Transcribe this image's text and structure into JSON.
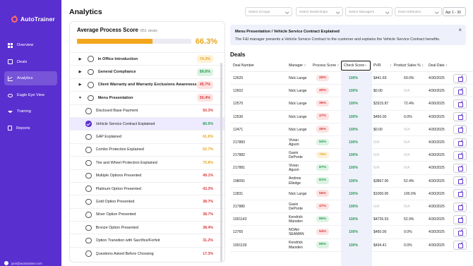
{
  "app": {
    "name": "AutoTrainer"
  },
  "sidebar": {
    "items": [
      {
        "label": "Overview",
        "icon": "grid-icon"
      },
      {
        "label": "Deals",
        "icon": "box-icon"
      },
      {
        "label": "Analytics",
        "icon": "chart-icon",
        "active": true
      },
      {
        "label": "Eagle Eye View",
        "icon": "eye-icon"
      },
      {
        "label": "Training",
        "icon": "graduation-cap-icon"
      },
      {
        "label": "Reports",
        "icon": "document-icon"
      }
    ],
    "user_email": "jack@autotrainer.com"
  },
  "header": {
    "title": "Analytics",
    "filters": [
      "Select Groups",
      "Select Dealerships",
      "Select Managers",
      "Deal Attribution"
    ],
    "date_range": "Apr 1 - 30"
  },
  "process_score": {
    "title": "Average Process Score",
    "deals_count": "851 deals",
    "overall": "66.3%",
    "progress_fraction": 0.663,
    "rows": [
      {
        "label": "In Office Introduction",
        "pct": "74.3%",
        "level": "top",
        "expand": "▶",
        "color": "#e7a61a",
        "bg": "#fff1d8"
      },
      {
        "label": "General Compliance",
        "pct": "89.6%",
        "level": "top",
        "expand": "▶",
        "color": "#2a9b53",
        "bg": "#dcf3e3"
      },
      {
        "label": "Client Warranty and Warranty Exclusions Awareness",
        "pct": "45.7%",
        "level": "top",
        "expand": "▶",
        "color": "#d83a3a",
        "bg": "#fde2e2"
      },
      {
        "label": "Menu Presentation",
        "pct": "50.4%",
        "level": "top",
        "expand": "▼",
        "color": "#d83a3a",
        "bg": "#fde2e2"
      },
      {
        "label": "Disclosed Base Payment",
        "pct": "50.3%",
        "level": "sub",
        "color": "#d83a3a"
      },
      {
        "label": "Vehicle Service Contract Explained",
        "pct": "80.5%",
        "level": "sub",
        "color": "#2a9b53",
        "selected": true
      },
      {
        "label": "GAP Explained",
        "pct": "61.6%",
        "level": "sub",
        "color": "#e7a61a"
      },
      {
        "label": "Combo Protection Explained",
        "pct": "62.7%",
        "level": "sub",
        "color": "#e7a61a"
      },
      {
        "label": "Tire and Wheel Protection Explained",
        "pct": "75.8%",
        "level": "sub",
        "color": "#e7a61a"
      },
      {
        "label": "Multiple Options Presented",
        "pct": "49.1%",
        "level": "sub",
        "color": "#d83a3a"
      },
      {
        "label": "Platinum Option Presented",
        "pct": "43.3%",
        "level": "sub",
        "color": "#d83a3a"
      },
      {
        "label": "Gold Option Presented",
        "pct": "38.7%",
        "level": "sub",
        "color": "#d83a3a"
      },
      {
        "label": "Silver Option Presented",
        "pct": "38.7%",
        "level": "sub",
        "color": "#d83a3a"
      },
      {
        "label": "Bronze Option Presented",
        "pct": "38.4%",
        "level": "sub",
        "color": "#d83a3a"
      },
      {
        "label": "Option Transition with Sacrifice/Forfeit",
        "pct": "31.2%",
        "level": "sub",
        "color": "#d83a3a"
      },
      {
        "label": "Questions Asked Before Choosing",
        "pct": "17.3%",
        "level": "sub",
        "color": "#d83a3a"
      }
    ]
  },
  "banner": {
    "title": "Menu Presentation / Vehicle Service Contract Explained",
    "text": "The F&I manager presents a Vehicle Service Contract to the customer and explains the Vehicle Service Contract benefits.",
    "close": "×"
  },
  "deals": {
    "title": "Deals",
    "columns": [
      "Deal Number",
      "Manager",
      "Process Score",
      "Check Score",
      "PVR",
      "Product Sales %",
      "Deal Date"
    ],
    "rows": [
      {
        "deal": "12625",
        "manager": "Nick Lange",
        "score": "45%",
        "check": "100%",
        "pvr": "$441.69",
        "sales": "69.0%",
        "date": "4/30/2025",
        "band": "red"
      },
      {
        "deal": "12602",
        "manager": "Nick Lange",
        "score": "40%",
        "check": "100%",
        "pvr": "$0.00",
        "sales": "N/A",
        "date": "4/30/2025",
        "band": "red"
      },
      {
        "deal": "12570",
        "manager": "Nick Lange",
        "score": "36%",
        "check": "100%",
        "pvr": "$3315.87",
        "sales": "72.4%",
        "date": "4/30/2025",
        "band": "red"
      },
      {
        "deal": "12536",
        "manager": "Nick Lange",
        "score": "47%",
        "check": "100%",
        "pvr": "$450.00",
        "sales": "0.0%",
        "date": "4/30/2025",
        "band": "red"
      },
      {
        "deal": "12471",
        "manager": "Nick Lange",
        "score": "45%",
        "check": "100%",
        "pvr": "$0.00",
        "sales": "N/A",
        "date": "4/30/2025",
        "band": "red"
      },
      {
        "deal": "217883",
        "manager": "Vivian Aguon",
        "score": "94%",
        "check": "100%",
        "pvr": "N/A",
        "sales": "N/A",
        "date": "4/30/2025",
        "band": "green"
      },
      {
        "deal": "217882",
        "manager": "Gavin DePonte",
        "score": "75%",
        "check": "100%",
        "pvr": "N/A",
        "sales": "N/A",
        "date": "4/30/2025",
        "band": "yellow"
      },
      {
        "deal": "217881",
        "manager": "Vivian Aguon",
        "score": "87%",
        "check": "100%",
        "pvr": "N/A",
        "sales": "N/A",
        "date": "4/30/2025",
        "band": "green"
      },
      {
        "deal": "198091",
        "manager": "Andrew Elledge",
        "score": "81%",
        "check": "100%",
        "pvr": "$3867.00",
        "sales": "52.4%",
        "date": "4/30/2025",
        "band": "green"
      },
      {
        "deal": "12831",
        "manager": "Nick Lange",
        "score": "55%",
        "check": "100%",
        "pvr": "$1000.00",
        "sales": "100.0%",
        "date": "4/30/2025",
        "band": "red"
      },
      {
        "deal": "217880",
        "manager": "Gavin DePonte",
        "score": "47%",
        "check": "100%",
        "pvr": "N/A",
        "sales": "N/A",
        "date": "4/30/2025",
        "band": "red"
      },
      {
        "deal": "1001143",
        "manager": "Kendrick Marsden",
        "score": "86%",
        "check": "100%",
        "pvr": "$4726.53",
        "sales": "52.9%",
        "date": "4/30/2025",
        "band": "green"
      },
      {
        "deal": "12765",
        "manager": "NOAH SEAMAN",
        "score": "54%",
        "check": "100%",
        "pvr": "$450.00",
        "sales": "0.0%",
        "date": "4/30/2025",
        "band": "red"
      },
      {
        "deal": "1001139",
        "manager": "Kendrick Marsden",
        "score": "80%",
        "check": "100%",
        "pvr": "$434.41",
        "sales": "0.0%",
        "date": "4/30/2025",
        "band": "green"
      }
    ]
  },
  "colors": {
    "brand": "#5a2fd0",
    "red_text": "#d83a3a",
    "red_bg": "#fde2e2",
    "green_text": "#2a9b53",
    "green_bg": "#dcf3e3",
    "yellow_text": "#e7a61a",
    "yellow_bg": "#fff1d8"
  }
}
